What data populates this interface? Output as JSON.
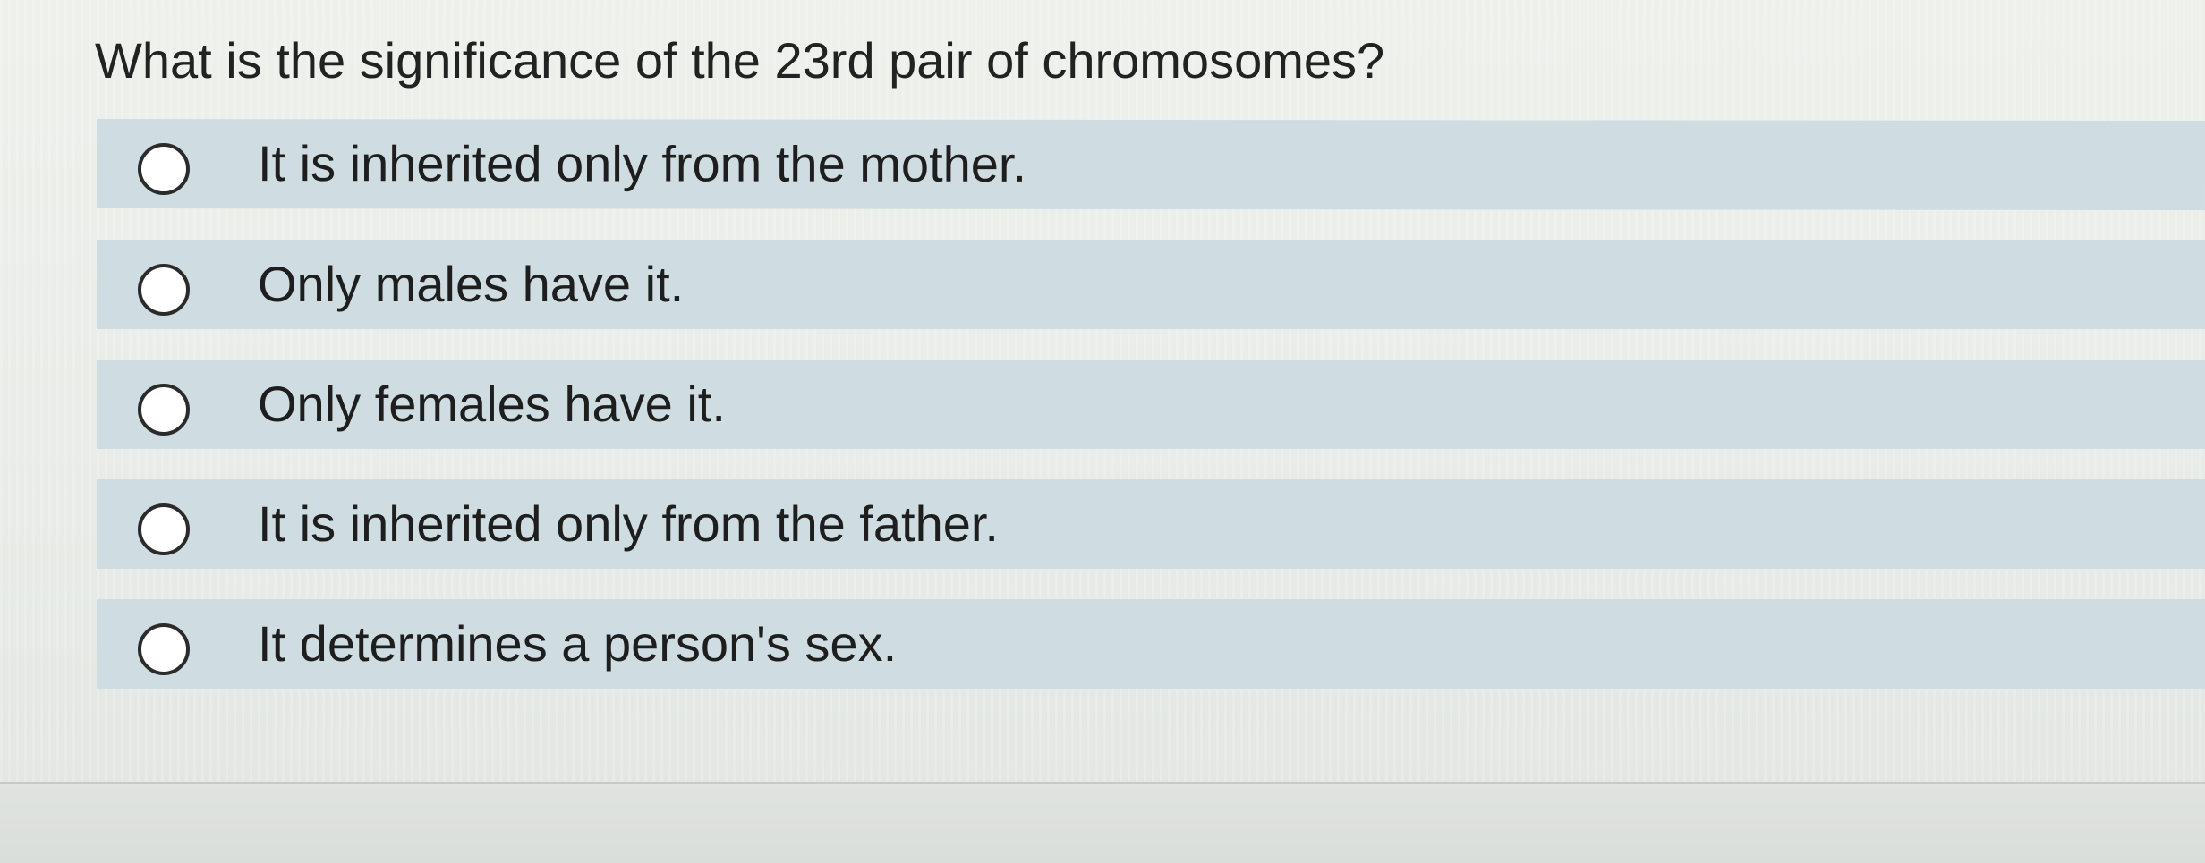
{
  "question": {
    "text": "What is the significance of the 23rd pair of chromosomes?"
  },
  "options": [
    {
      "label": "It is inherited only from the mother.",
      "selected": false
    },
    {
      "label": "Only males have it.",
      "selected": false
    },
    {
      "label": "Only females have it.",
      "selected": false
    },
    {
      "label": "It is inherited only from the father.",
      "selected": false
    },
    {
      "label": "It determines a person's sex.",
      "selected": false
    }
  ],
  "colors": {
    "option_background": "#cfdde3",
    "page_background": "#e9ebe8",
    "text": "#1f1f1f"
  }
}
